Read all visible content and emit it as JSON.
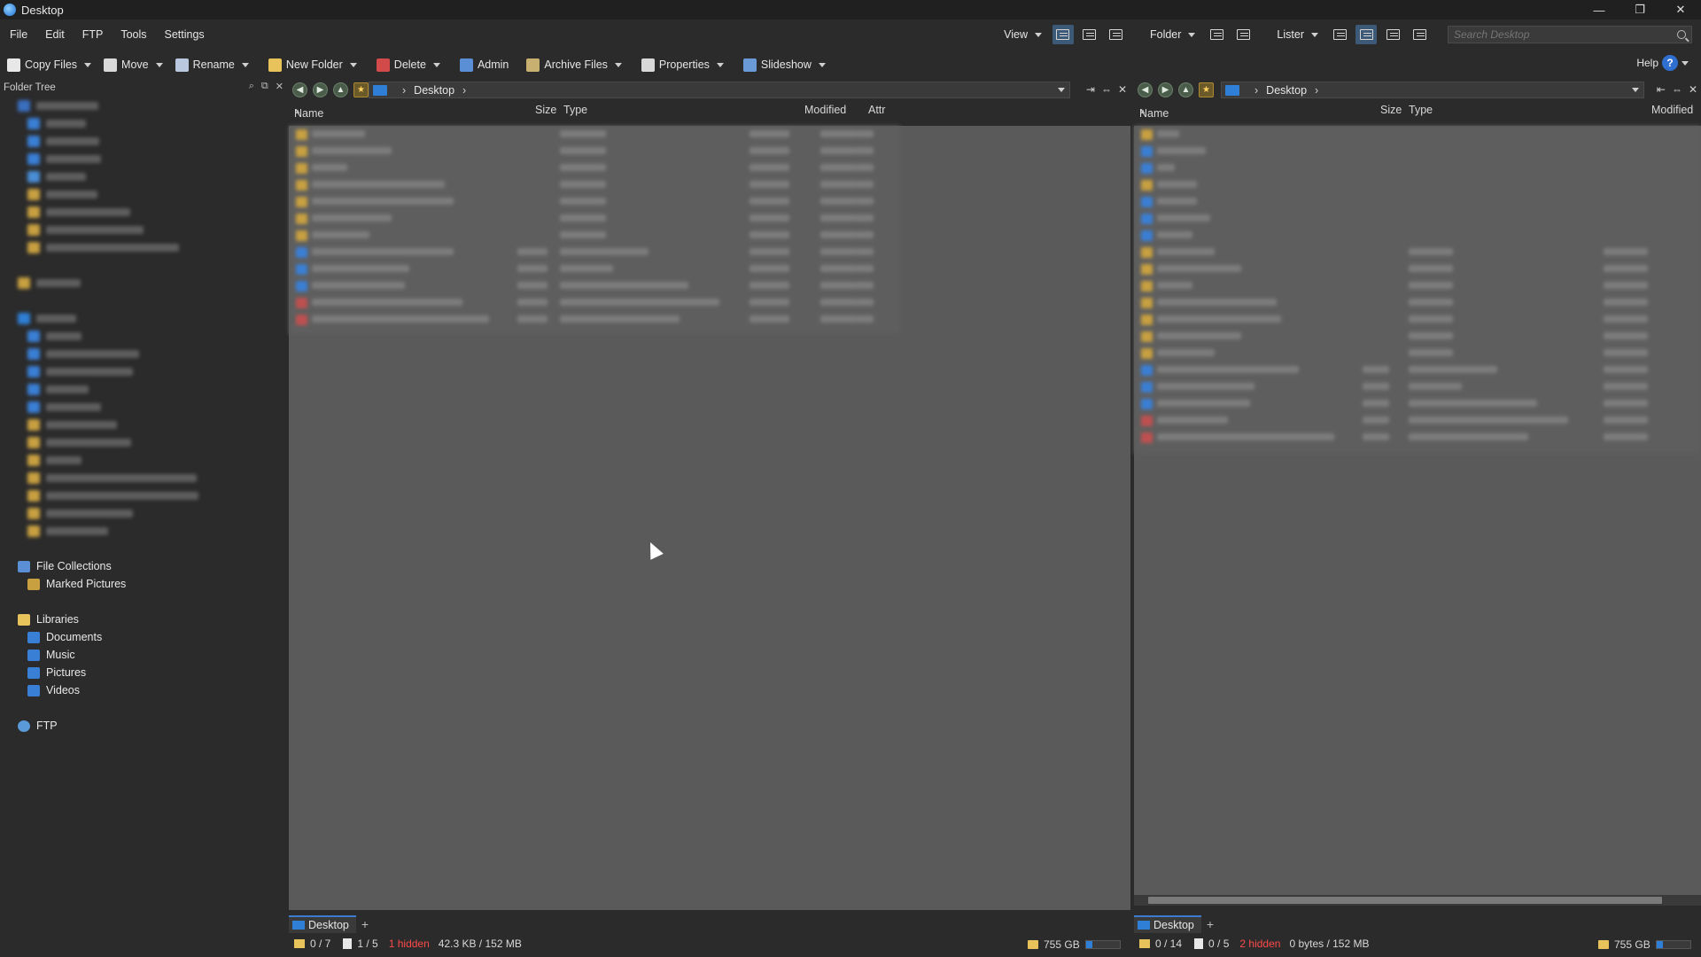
{
  "window": {
    "title": "Desktop",
    "controls": [
      "—",
      "❐",
      "✕"
    ]
  },
  "menu": [
    "File",
    "Edit",
    "FTP",
    "Tools",
    "Settings"
  ],
  "right_toolbar": {
    "view_label": "View",
    "folder_label": "Folder",
    "lister_label": "Lister",
    "search_placeholder": "Search Desktop"
  },
  "actions": {
    "copy": "Copy Files",
    "move": "Move",
    "rename": "Rename",
    "new_folder": "New Folder",
    "delete": "Delete",
    "admin": "Admin",
    "archive": "Archive Files",
    "properties": "Properties",
    "slideshow": "Slideshow",
    "help": "Help"
  },
  "tree": {
    "header": "Folder Tree",
    "collections": "File Collections",
    "marked_pictures": "Marked Pictures",
    "libraries": "Libraries",
    "lib_items": [
      "Documents",
      "Music",
      "Pictures",
      "Videos"
    ],
    "ftp": "FTP"
  },
  "left_pane": {
    "path": "Desktop",
    "columns": {
      "name": "Name",
      "size": "Size",
      "type": "Type",
      "modified": "Modified",
      "attr": "Attr"
    },
    "tab": "Desktop",
    "status": {
      "folders": "0 / 7",
      "files": "1 / 5",
      "hidden": "1 hidden",
      "size": "42.3 KB / 152 MB",
      "drive": "755 GB"
    }
  },
  "right_pane": {
    "path": "Desktop",
    "columns": {
      "name": "Name",
      "size": "Size",
      "type": "Type",
      "modified": "Modified"
    },
    "tab": "Desktop",
    "status": {
      "folders": "0 / 14",
      "files": "0 / 5",
      "hidden": "2 hidden",
      "size": "0 bytes / 152 MB",
      "drive": "755 GB"
    }
  },
  "colors": {
    "accent": "#2f7fd6",
    "folder": "#e8c25a",
    "hidden_text": "#ff4a4a",
    "pane_bg": "#5e5e5e"
  },
  "icons": {
    "folder": "folder-icon",
    "file": "file-icon",
    "pc": "this-pc-icon",
    "search": "search-icon",
    "help": "help-icon"
  }
}
